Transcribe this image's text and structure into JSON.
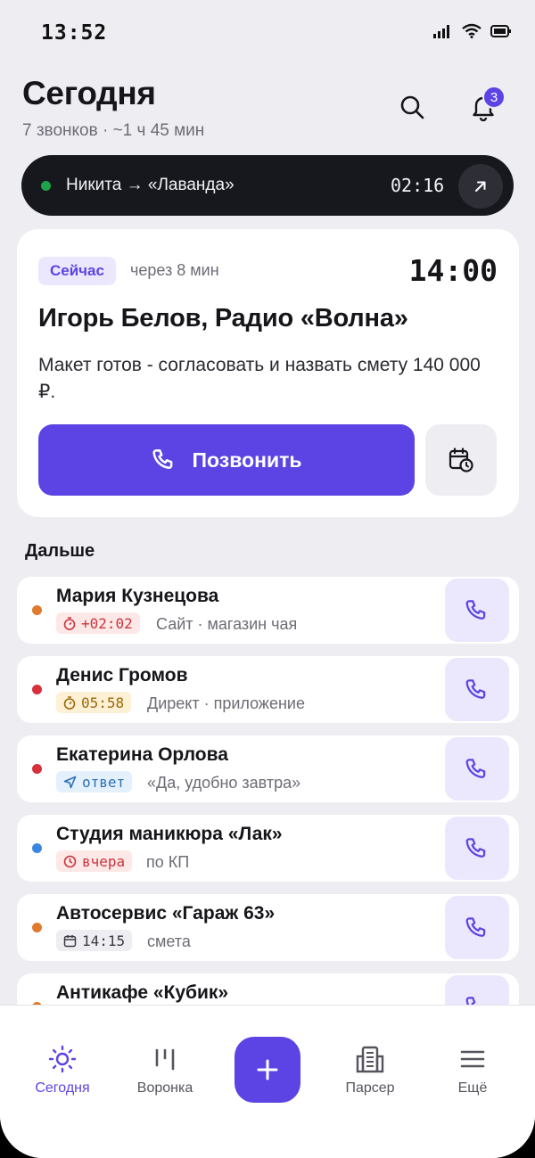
{
  "status_bar": {
    "time": "13:52"
  },
  "header": {
    "title": "Сегодня",
    "subtitle": "7 звонков · ~1 ч 45 мин",
    "notification_count": "3"
  },
  "active_call": {
    "label": "Никита → «Лаванда»",
    "timer": "02:16"
  },
  "next_call": {
    "badge": "Сейчас",
    "in_time": "через 8 мин",
    "time": "14:00",
    "name": "Игорь Белов, Радио «Волна»",
    "note": "Макет готов - согласовать и назвать смету 140 000 ₽.",
    "call_label": "Позвонить"
  },
  "section_title": "Дальше",
  "colors": {
    "accent": "#5b44e3",
    "accent_light": "#ebe8fd",
    "dot_orange": "#e07a2e",
    "dot_red": "#d6303a",
    "dot_blue": "#3b86e0",
    "active_green": "#1fa34a"
  },
  "list": [
    {
      "name": "Мария Кузнецова",
      "dot": "#e07a2e",
      "tag_icon": "stopwatch-icon",
      "tag": "+02:02",
      "tag_bg": "#fde8e8",
      "tag_color": "#c9353c",
      "meta": "Сайт · магазин чая"
    },
    {
      "name": "Денис Громов",
      "dot": "#d6303a",
      "tag_icon": "stopwatch-icon",
      "tag": "05:58",
      "tag_bg": "#fdf0d4",
      "tag_color": "#9a6a0a",
      "meta": "Директ · приложение"
    },
    {
      "name": "Екатерина Орлова",
      "dot": "#d6303a",
      "tag_icon": "send-icon",
      "tag": "ответ",
      "tag_bg": "#e4f0fc",
      "tag_color": "#2a6fb8",
      "meta": "«Да, удобно завтра»"
    },
    {
      "name": "Студия маникюра «Лак»",
      "dot": "#3b86e0",
      "tag_icon": "clock-icon",
      "tag": "вчера",
      "tag_bg": "#fde8e8",
      "tag_color": "#c9353c",
      "meta": "по КП"
    },
    {
      "name": "Автосервис «Гараж 63»",
      "dot": "#e07a2e",
      "tag_icon": "calendar-icon",
      "tag": "14:15",
      "tag_bg": "#eeeef2",
      "tag_color": "#3a3a42",
      "meta": "смета"
    },
    {
      "name": "Антикафе «Кубик»",
      "dot": "#e07a2e",
      "tag_icon": "",
      "tag": "",
      "tag_bg": "#eeeef2",
      "tag_color": "#3a3a42",
      "meta": ""
    }
  ],
  "bottom_nav": {
    "today": "Сегодня",
    "funnel": "Воронка",
    "parser": "Парсер",
    "more": "Ещё"
  }
}
